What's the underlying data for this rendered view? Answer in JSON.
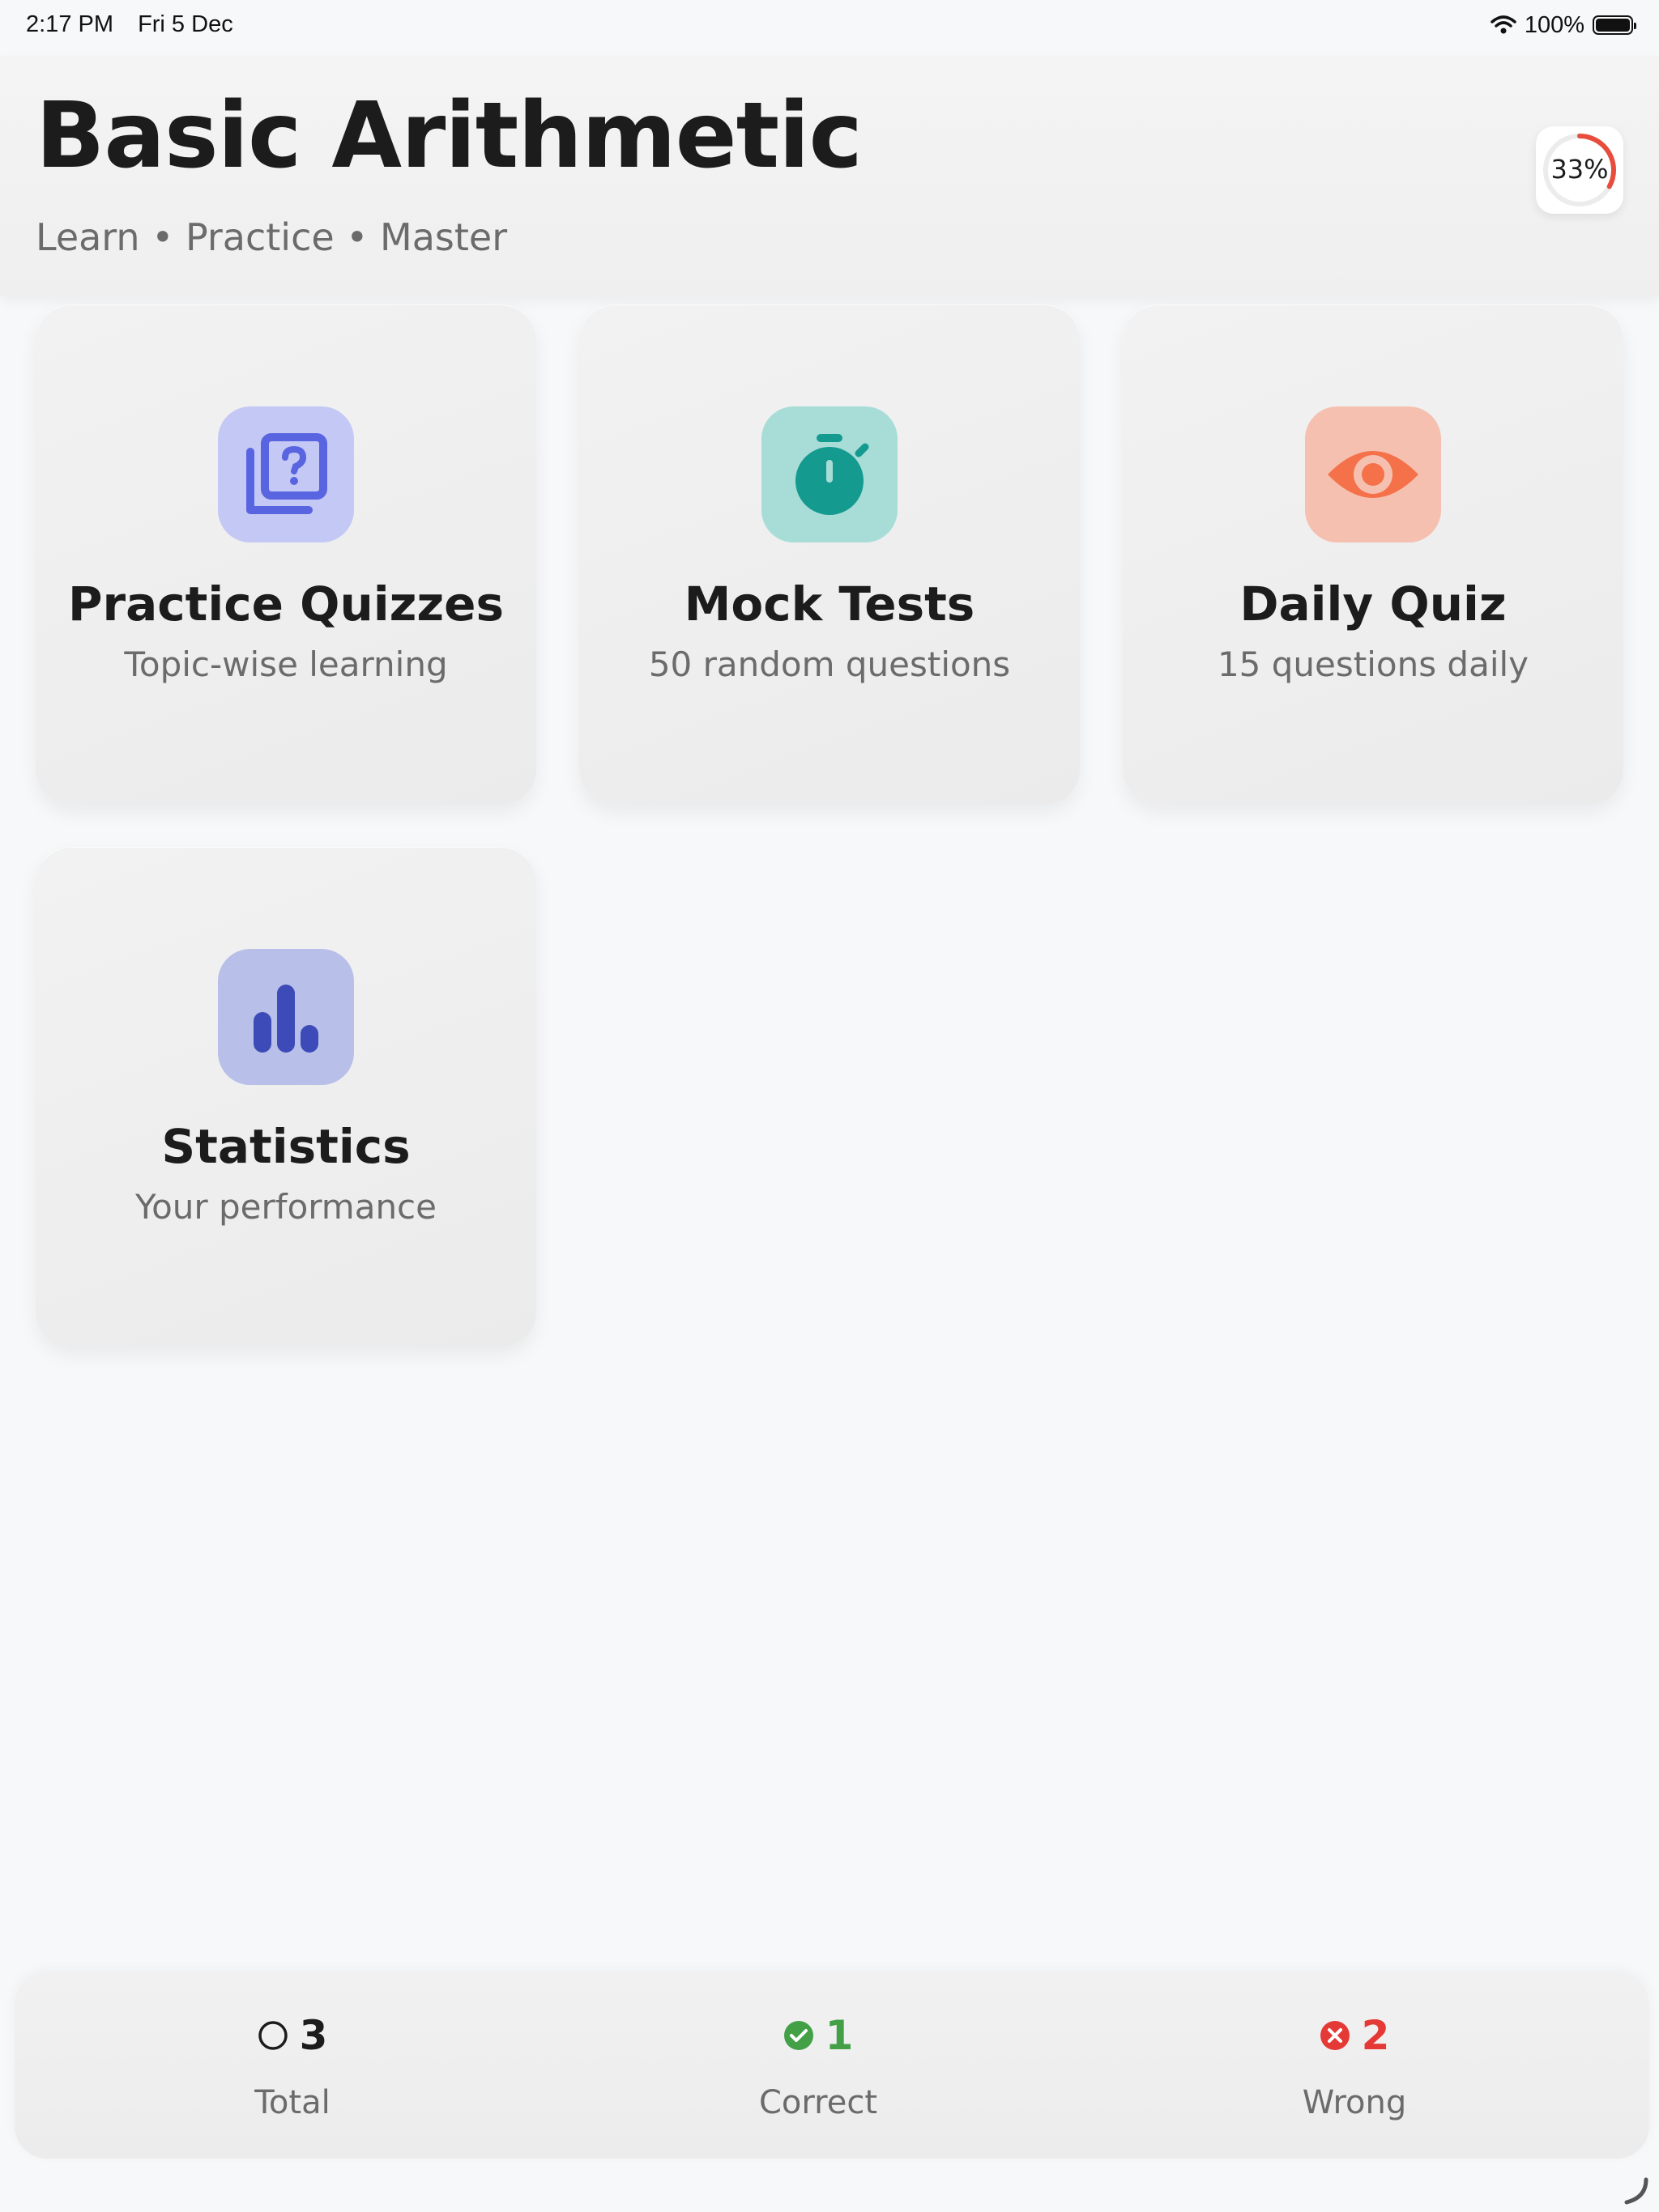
{
  "status_bar": {
    "time": "2:17 PM",
    "date": "Fri 5 Dec",
    "battery": "100%"
  },
  "header": {
    "title": "Basic Arithmetic",
    "subtitle": "Learn • Practice • Master",
    "progress": {
      "label": "33%",
      "fraction": 0.33,
      "color": "#e74c3c"
    }
  },
  "cards": [
    {
      "title": "Practice Quizzes",
      "subtitle": "Topic-wise learning",
      "icon": "quiz-stack-icon",
      "icon_bg": "#c4c8f5",
      "icon_color": "#5964e0"
    },
    {
      "title": "Mock Tests",
      "subtitle": "50 random questions",
      "icon": "stopwatch-icon",
      "icon_bg": "#a8ddd7",
      "icon_color": "#149a8f"
    },
    {
      "title": "Daily Quiz",
      "subtitle": "15 questions daily",
      "icon": "eye-icon",
      "icon_bg": "#f6c0b0",
      "icon_color": "#f4714a"
    },
    {
      "title": "Statistics",
      "subtitle": "Your performance",
      "icon": "bar-chart-icon",
      "icon_bg": "#b8bfe8",
      "icon_color": "#3d4bb8"
    }
  ],
  "stats": {
    "total": {
      "value": "3",
      "label": "Total",
      "color": "#1c1c1c"
    },
    "correct": {
      "value": "1",
      "label": "Correct",
      "color": "#43a047"
    },
    "wrong": {
      "value": "2",
      "label": "Wrong",
      "color": "#e53935"
    }
  }
}
